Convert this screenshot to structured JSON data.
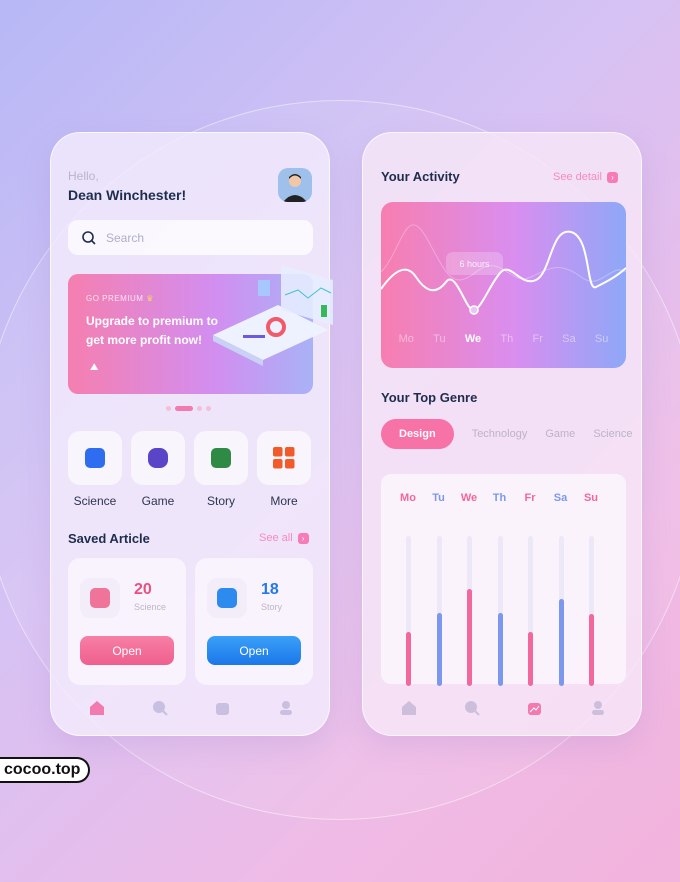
{
  "home": {
    "greeting": "Hello,",
    "user_name": "Dean Winchester!",
    "search_placeholder": "Search",
    "banner": {
      "tag": "GO PREMIUM",
      "text": "Upgrade to premium to get more profit now!"
    },
    "categories": [
      {
        "label": "Science",
        "icon": "chart-icon",
        "color": "#2f6df0"
      },
      {
        "label": "Game",
        "icon": "gamepad-icon",
        "color": "#5a45c8"
      },
      {
        "label": "Story",
        "icon": "document-icon",
        "color": "#2f8a45"
      },
      {
        "label": "More",
        "icon": "grid-icon",
        "color": "#f25a2a"
      }
    ],
    "saved": {
      "title": "Saved Article",
      "see_all": "See all",
      "items": [
        {
          "count": "20",
          "category": "Science",
          "button": "Open",
          "color": "#f25f8e"
        },
        {
          "count": "18",
          "category": "Story",
          "button": "Open",
          "color": "#2d8bf0"
        }
      ]
    }
  },
  "stats": {
    "activity_title": "Your Activity",
    "see_detail": "See detail",
    "tooltip": "6 hours",
    "days": [
      "Mo",
      "Tu",
      "We",
      "Th",
      "Fr",
      "Sa",
      "Su"
    ],
    "selected_day": "We",
    "genre_title": "Your Top Genre",
    "genres": [
      "Design",
      "Technology",
      "Game",
      "Science"
    ],
    "selected_genre": "Design",
    "chart_data": {
      "type": "bar",
      "categories": [
        "Mo",
        "Tu",
        "We",
        "Th",
        "Fr",
        "Sa",
        "Su"
      ],
      "values": [
        0.36,
        0.49,
        0.65,
        0.49,
        0.36,
        0.58,
        0.48
      ],
      "colors": [
        "#f2679c",
        "#7c98ee",
        "#f2679c",
        "#7c98ee",
        "#f2679c",
        "#7c98ee",
        "#f2679c"
      ]
    }
  },
  "nav": [
    "home-icon",
    "search-icon",
    "stats-icon",
    "profile-icon"
  ],
  "accent": "#f772a7",
  "watermark": "cocoo.top"
}
